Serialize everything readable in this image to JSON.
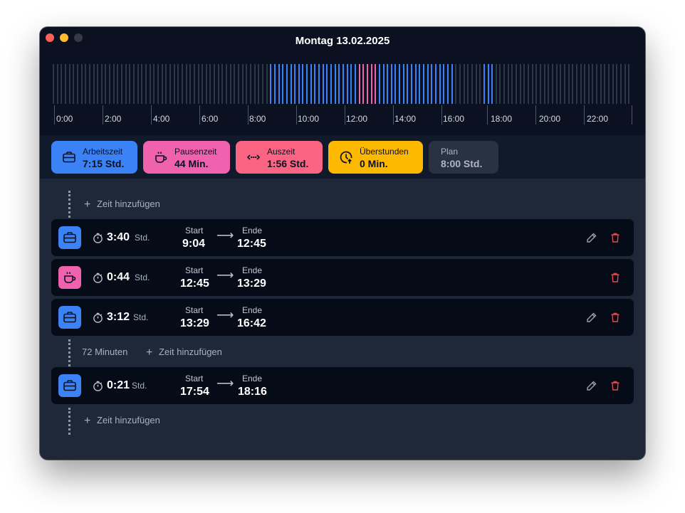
{
  "window": {
    "title": "Montag 13.02.2025"
  },
  "timeline": {
    "hour_labels": [
      "0:00",
      "2:00",
      "4:00",
      "6:00",
      "8:00",
      "10:00",
      "12:00",
      "14:00",
      "16:00",
      "18:00",
      "20:00",
      "22:00"
    ],
    "slot_minutes": 10,
    "colors": {
      "work": "#3b82f6",
      "pause": "#f062ae",
      "empty": "#2e3747"
    }
  },
  "summary": {
    "work": {
      "label": "Arbeitszeit",
      "value": "7:15 Std."
    },
    "pause": {
      "label": "Pausenzeit",
      "value": "44 Min."
    },
    "off": {
      "label": "Auszeit",
      "value": "1:56 Std."
    },
    "overtime": {
      "label": "Überstunden",
      "value": "0 Min."
    },
    "plan": {
      "label": "Plan",
      "value": "8:00 Std."
    }
  },
  "add_time_label": "Zeit hinzufügen",
  "gap_text": "72 Minuten",
  "entry_labels": {
    "start": "Start",
    "end": "Ende",
    "unit": "Std."
  },
  "entries": [
    {
      "type": "work",
      "duration": "3:40",
      "start": "9:04",
      "end": "12:45",
      "editable": true
    },
    {
      "type": "pause",
      "duration": "0:44",
      "start": "12:45",
      "end": "13:29",
      "editable": false
    },
    {
      "type": "work",
      "duration": "3:12",
      "start": "13:29",
      "end": "16:42",
      "editable": true
    },
    {
      "type": "work",
      "duration": "0:21",
      "start": "17:54",
      "end": "18:16",
      "editable": true
    }
  ]
}
